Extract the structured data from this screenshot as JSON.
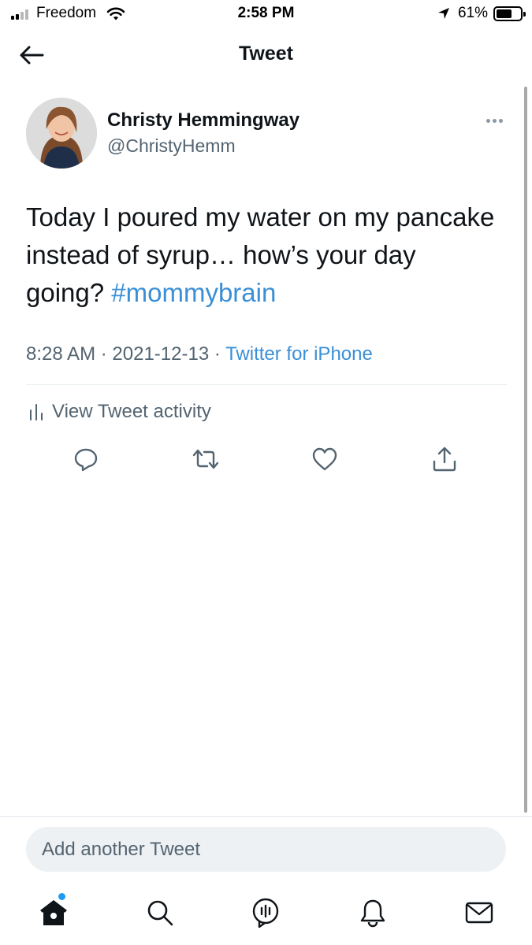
{
  "status_bar": {
    "carrier": "Freedom",
    "time": "2:58 PM",
    "battery_percent": "61%",
    "battery_level": 0.61,
    "signal_bars_active": 2,
    "signal_bars_total": 4,
    "icons": [
      "signal-icon",
      "wifi-icon",
      "location-arrow-icon",
      "battery-icon"
    ]
  },
  "header": {
    "title": "Tweet",
    "back_icon": "arrow-left-icon"
  },
  "tweet": {
    "author": {
      "name": "Christy Hemmingway",
      "handle": "@ChristyHemm"
    },
    "text": "Today I poured my water on my pancake instead of syrup… how’s your day going? ",
    "hashtag": "#mommybrain",
    "time": "8:28 AM",
    "separator": "·",
    "date": "2021-12-13",
    "source": "Twitter for iPhone",
    "more_icon": "more-horizontal-icon"
  },
  "activity": {
    "label": "View Tweet activity",
    "icon": "activity-bars-icon"
  },
  "actions": [
    {
      "name": "reply",
      "icon": "reply-icon"
    },
    {
      "name": "retweet",
      "icon": "retweet-icon"
    },
    {
      "name": "like",
      "icon": "heart-icon"
    },
    {
      "name": "share",
      "icon": "share-icon"
    }
  ],
  "compose": {
    "placeholder": "Add another Tweet",
    "value": ""
  },
  "tab_bar": {
    "tabs": [
      {
        "name": "home",
        "icon": "home-icon",
        "has_notification_dot": true
      },
      {
        "name": "search",
        "icon": "search-icon"
      },
      {
        "name": "spaces",
        "icon": "spaces-icon"
      },
      {
        "name": "notifications",
        "icon": "bell-icon"
      },
      {
        "name": "messages",
        "icon": "mail-icon"
      }
    ]
  },
  "colors": {
    "link": "#3a8fd6",
    "text_primary": "#0f1419",
    "text_secondary": "#536471",
    "notification_dot": "#1d9bf0",
    "compose_bg": "#eef1f3"
  }
}
